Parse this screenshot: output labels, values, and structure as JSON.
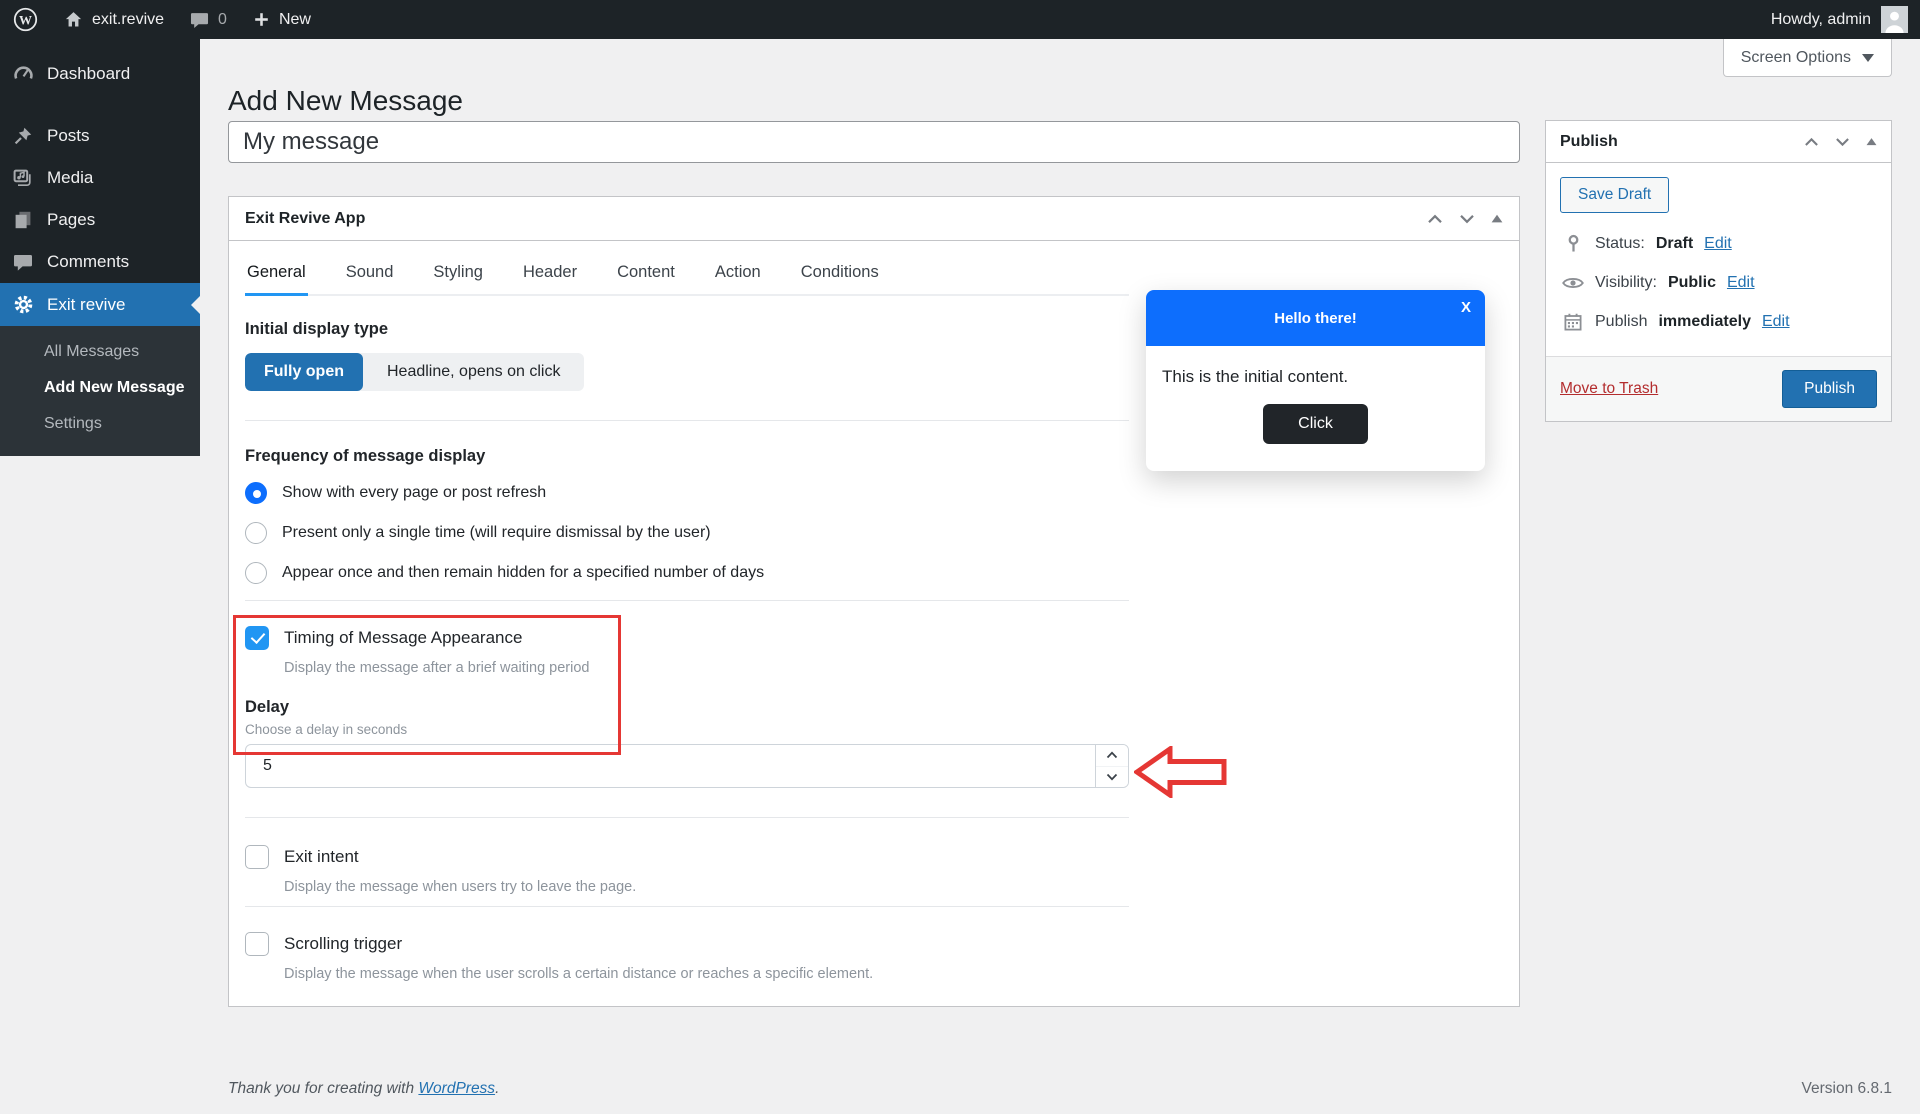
{
  "admin_bar": {
    "site_name": "exit.revive",
    "comment_count": "0",
    "new_label": "New",
    "howdy": "Howdy, admin"
  },
  "sidebar": {
    "items": [
      {
        "label": "Dashboard"
      },
      {
        "label": "Posts"
      },
      {
        "label": "Media"
      },
      {
        "label": "Pages"
      },
      {
        "label": "Comments"
      },
      {
        "label": "Exit revive"
      }
    ],
    "submenu": [
      {
        "label": "All Messages"
      },
      {
        "label": "Add New Message"
      },
      {
        "label": "Settings"
      }
    ]
  },
  "screen_options": {
    "label": "Screen Options"
  },
  "page": {
    "heading": "Add New Message",
    "post_title_value": "My message"
  },
  "metabox": {
    "title": "Exit Revive App",
    "tabs": [
      "General",
      "Sound",
      "Styling",
      "Header",
      "Content",
      "Action",
      "Conditions"
    ]
  },
  "general_tab": {
    "initial_display": {
      "label": "Initial display type",
      "selected_option": "Fully open",
      "other_option": "Headline, opens on click"
    },
    "frequency": {
      "label": "Frequency of message display",
      "options": [
        "Show with every page or post refresh",
        "Present only a single time (will require dismissal by the user)",
        "Appear once and then remain hidden for a specified number of days"
      ],
      "selected_index": 0
    },
    "timing": {
      "label": "Timing of Message Appearance",
      "description": "Display the message after a brief waiting period",
      "checked": true
    },
    "delay": {
      "label": "Delay",
      "hint": "Choose a delay in seconds",
      "value": "5"
    },
    "exit_intent": {
      "label": "Exit intent",
      "description": "Display the message when users try to leave the page.",
      "checked": false
    },
    "scrolling": {
      "label": "Scrolling trigger",
      "description": "Display the message when the user scrolls a certain distance or reaches a specific element.",
      "checked": false
    }
  },
  "preview_popup": {
    "title": "Hello there!",
    "close_label": "X",
    "body_text": "This is the initial content.",
    "button_label": "Click"
  },
  "publish_box": {
    "title": "Publish",
    "save_draft": "Save Draft",
    "status_label": "Status:",
    "status_value": "Draft",
    "visibility_label": "Visibility:",
    "visibility_value": "Public",
    "schedule_label": "Publish",
    "schedule_value": "immediately",
    "edit_label": "Edit",
    "move_to_trash": "Move to Trash",
    "publish_button": "Publish"
  },
  "footer": {
    "thanks_text": "Thank you for creating with",
    "wordpress_link": "WordPress",
    "period": ".",
    "version": "Version 6.8.1"
  },
  "colors": {
    "admin_dark": "#1d2327",
    "wp_accent_blue": "#2271b1",
    "bootstrap_blue": "#0d6efd",
    "tab_underline_blue": "#2196f3",
    "annotation_red": "#e53734",
    "body_background": "#f0f0f1"
  }
}
